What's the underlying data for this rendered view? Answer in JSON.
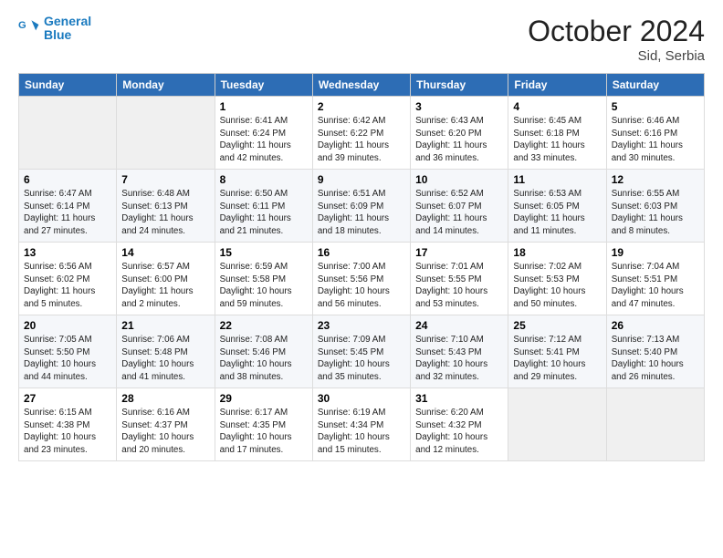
{
  "header": {
    "logo_line1": "General",
    "logo_line2": "Blue",
    "month_title": "October 2024",
    "location": "Sid, Serbia"
  },
  "days_of_week": [
    "Sunday",
    "Monday",
    "Tuesday",
    "Wednesday",
    "Thursday",
    "Friday",
    "Saturday"
  ],
  "weeks": [
    [
      {
        "num": "",
        "sunrise": "",
        "sunset": "",
        "daylight": ""
      },
      {
        "num": "",
        "sunrise": "",
        "sunset": "",
        "daylight": ""
      },
      {
        "num": "1",
        "sunrise": "Sunrise: 6:41 AM",
        "sunset": "Sunset: 6:24 PM",
        "daylight": "Daylight: 11 hours and 42 minutes."
      },
      {
        "num": "2",
        "sunrise": "Sunrise: 6:42 AM",
        "sunset": "Sunset: 6:22 PM",
        "daylight": "Daylight: 11 hours and 39 minutes."
      },
      {
        "num": "3",
        "sunrise": "Sunrise: 6:43 AM",
        "sunset": "Sunset: 6:20 PM",
        "daylight": "Daylight: 11 hours and 36 minutes."
      },
      {
        "num": "4",
        "sunrise": "Sunrise: 6:45 AM",
        "sunset": "Sunset: 6:18 PM",
        "daylight": "Daylight: 11 hours and 33 minutes."
      },
      {
        "num": "5",
        "sunrise": "Sunrise: 6:46 AM",
        "sunset": "Sunset: 6:16 PM",
        "daylight": "Daylight: 11 hours and 30 minutes."
      }
    ],
    [
      {
        "num": "6",
        "sunrise": "Sunrise: 6:47 AM",
        "sunset": "Sunset: 6:14 PM",
        "daylight": "Daylight: 11 hours and 27 minutes."
      },
      {
        "num": "7",
        "sunrise": "Sunrise: 6:48 AM",
        "sunset": "Sunset: 6:13 PM",
        "daylight": "Daylight: 11 hours and 24 minutes."
      },
      {
        "num": "8",
        "sunrise": "Sunrise: 6:50 AM",
        "sunset": "Sunset: 6:11 PM",
        "daylight": "Daylight: 11 hours and 21 minutes."
      },
      {
        "num": "9",
        "sunrise": "Sunrise: 6:51 AM",
        "sunset": "Sunset: 6:09 PM",
        "daylight": "Daylight: 11 hours and 18 minutes."
      },
      {
        "num": "10",
        "sunrise": "Sunrise: 6:52 AM",
        "sunset": "Sunset: 6:07 PM",
        "daylight": "Daylight: 11 hours and 14 minutes."
      },
      {
        "num": "11",
        "sunrise": "Sunrise: 6:53 AM",
        "sunset": "Sunset: 6:05 PM",
        "daylight": "Daylight: 11 hours and 11 minutes."
      },
      {
        "num": "12",
        "sunrise": "Sunrise: 6:55 AM",
        "sunset": "Sunset: 6:03 PM",
        "daylight": "Daylight: 11 hours and 8 minutes."
      }
    ],
    [
      {
        "num": "13",
        "sunrise": "Sunrise: 6:56 AM",
        "sunset": "Sunset: 6:02 PM",
        "daylight": "Daylight: 11 hours and 5 minutes."
      },
      {
        "num": "14",
        "sunrise": "Sunrise: 6:57 AM",
        "sunset": "Sunset: 6:00 PM",
        "daylight": "Daylight: 11 hours and 2 minutes."
      },
      {
        "num": "15",
        "sunrise": "Sunrise: 6:59 AM",
        "sunset": "Sunset: 5:58 PM",
        "daylight": "Daylight: 10 hours and 59 minutes."
      },
      {
        "num": "16",
        "sunrise": "Sunrise: 7:00 AM",
        "sunset": "Sunset: 5:56 PM",
        "daylight": "Daylight: 10 hours and 56 minutes."
      },
      {
        "num": "17",
        "sunrise": "Sunrise: 7:01 AM",
        "sunset": "Sunset: 5:55 PM",
        "daylight": "Daylight: 10 hours and 53 minutes."
      },
      {
        "num": "18",
        "sunrise": "Sunrise: 7:02 AM",
        "sunset": "Sunset: 5:53 PM",
        "daylight": "Daylight: 10 hours and 50 minutes."
      },
      {
        "num": "19",
        "sunrise": "Sunrise: 7:04 AM",
        "sunset": "Sunset: 5:51 PM",
        "daylight": "Daylight: 10 hours and 47 minutes."
      }
    ],
    [
      {
        "num": "20",
        "sunrise": "Sunrise: 7:05 AM",
        "sunset": "Sunset: 5:50 PM",
        "daylight": "Daylight: 10 hours and 44 minutes."
      },
      {
        "num": "21",
        "sunrise": "Sunrise: 7:06 AM",
        "sunset": "Sunset: 5:48 PM",
        "daylight": "Daylight: 10 hours and 41 minutes."
      },
      {
        "num": "22",
        "sunrise": "Sunrise: 7:08 AM",
        "sunset": "Sunset: 5:46 PM",
        "daylight": "Daylight: 10 hours and 38 minutes."
      },
      {
        "num": "23",
        "sunrise": "Sunrise: 7:09 AM",
        "sunset": "Sunset: 5:45 PM",
        "daylight": "Daylight: 10 hours and 35 minutes."
      },
      {
        "num": "24",
        "sunrise": "Sunrise: 7:10 AM",
        "sunset": "Sunset: 5:43 PM",
        "daylight": "Daylight: 10 hours and 32 minutes."
      },
      {
        "num": "25",
        "sunrise": "Sunrise: 7:12 AM",
        "sunset": "Sunset: 5:41 PM",
        "daylight": "Daylight: 10 hours and 29 minutes."
      },
      {
        "num": "26",
        "sunrise": "Sunrise: 7:13 AM",
        "sunset": "Sunset: 5:40 PM",
        "daylight": "Daylight: 10 hours and 26 minutes."
      }
    ],
    [
      {
        "num": "27",
        "sunrise": "Sunrise: 6:15 AM",
        "sunset": "Sunset: 4:38 PM",
        "daylight": "Daylight: 10 hours and 23 minutes."
      },
      {
        "num": "28",
        "sunrise": "Sunrise: 6:16 AM",
        "sunset": "Sunset: 4:37 PM",
        "daylight": "Daylight: 10 hours and 20 minutes."
      },
      {
        "num": "29",
        "sunrise": "Sunrise: 6:17 AM",
        "sunset": "Sunset: 4:35 PM",
        "daylight": "Daylight: 10 hours and 17 minutes."
      },
      {
        "num": "30",
        "sunrise": "Sunrise: 6:19 AM",
        "sunset": "Sunset: 4:34 PM",
        "daylight": "Daylight: 10 hours and 15 minutes."
      },
      {
        "num": "31",
        "sunrise": "Sunrise: 6:20 AM",
        "sunset": "Sunset: 4:32 PM",
        "daylight": "Daylight: 10 hours and 12 minutes."
      },
      {
        "num": "",
        "sunrise": "",
        "sunset": "",
        "daylight": ""
      },
      {
        "num": "",
        "sunrise": "",
        "sunset": "",
        "daylight": ""
      }
    ]
  ]
}
